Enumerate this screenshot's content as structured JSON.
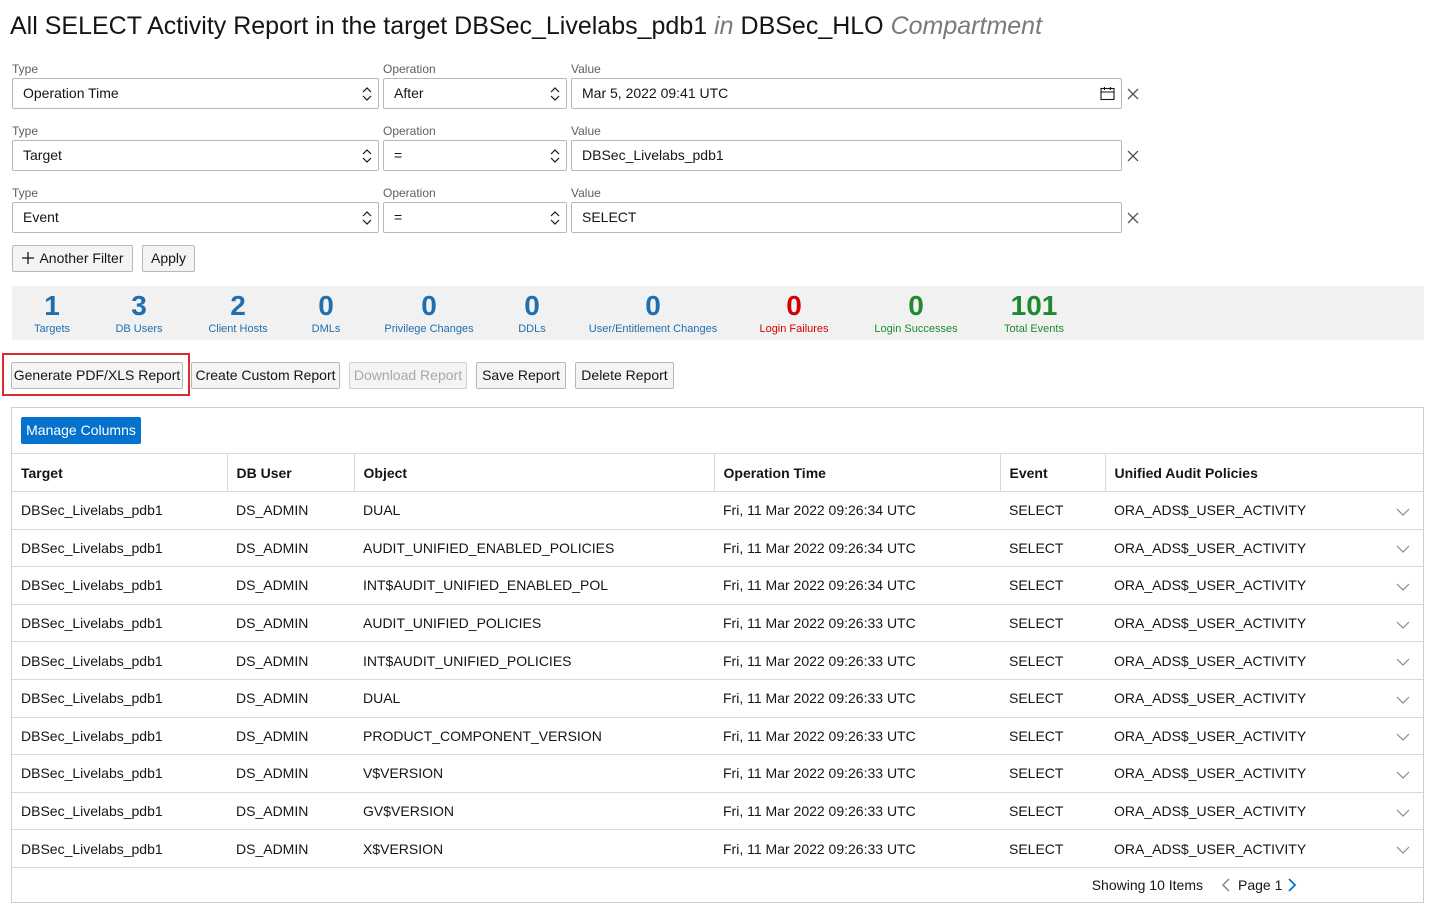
{
  "title": {
    "part1": "All SELECT Activity Report in the target DBSec_Livelabs_pdb1",
    "part2": "in",
    "part3": "DBSec_HLO",
    "part4": "Compartment"
  },
  "filters": [
    {
      "type_label": "Type",
      "type_value": "Operation Time",
      "op_label": "Operation",
      "op_value": "After",
      "value_label": "Value",
      "value": "Mar 5, 2022 09:41 UTC",
      "has_calendar": true
    },
    {
      "type_label": "Type",
      "type_value": "Target",
      "op_label": "Operation",
      "op_value": "=",
      "value_label": "Value",
      "value": "DBSec_Livelabs_pdb1",
      "has_calendar": false
    },
    {
      "type_label": "Type",
      "type_value": "Event",
      "op_label": "Operation",
      "op_value": "=",
      "value_label": "Value",
      "value": "SELECT",
      "has_calendar": false
    }
  ],
  "filter_actions": {
    "another_filter": "Another Filter",
    "apply": "Apply"
  },
  "stats": [
    {
      "value": "1",
      "label": "Targets",
      "color": "#1f6fb0"
    },
    {
      "value": "3",
      "label": "DB Users",
      "color": "#1f6fb0"
    },
    {
      "value": "2",
      "label": "Client Hosts",
      "color": "#1f6fb0"
    },
    {
      "value": "0",
      "label": "DMLs",
      "color": "#1f6fb0"
    },
    {
      "value": "0",
      "label": "Privilege Changes",
      "color": "#1f6fb0"
    },
    {
      "value": "0",
      "label": "DDLs",
      "color": "#1f6fb0"
    },
    {
      "value": "0",
      "label": "User/Entitlement Changes",
      "color": "#1f6fb0"
    },
    {
      "value": "0",
      "label": "Login Failures",
      "color": "#d40000"
    },
    {
      "value": "0",
      "label": "Login Successes",
      "color": "#1e8a30"
    },
    {
      "value": "101",
      "label": "Total Events",
      "color": "#1e8a30"
    }
  ],
  "report_buttons": {
    "generate": "Generate PDF/XLS Report",
    "create_custom": "Create Custom Report",
    "download": "Download Report",
    "save": "Save Report",
    "delete": "Delete Report"
  },
  "table": {
    "manage_columns": "Manage Columns",
    "headers": [
      "Target",
      "DB User",
      "Object",
      "Operation Time",
      "Event",
      "Unified Audit Policies"
    ],
    "rows": [
      [
        "DBSec_Livelabs_pdb1",
        "DS_ADMIN",
        "DUAL",
        "Fri, 11 Mar 2022 09:26:34 UTC",
        "SELECT",
        "ORA_ADS$_USER_ACTIVITY"
      ],
      [
        "DBSec_Livelabs_pdb1",
        "DS_ADMIN",
        "AUDIT_UNIFIED_ENABLED_POLICIES",
        "Fri, 11 Mar 2022 09:26:34 UTC",
        "SELECT",
        "ORA_ADS$_USER_ACTIVITY"
      ],
      [
        "DBSec_Livelabs_pdb1",
        "DS_ADMIN",
        "INT$AUDIT_UNIFIED_ENABLED_POL",
        "Fri, 11 Mar 2022 09:26:34 UTC",
        "SELECT",
        "ORA_ADS$_USER_ACTIVITY"
      ],
      [
        "DBSec_Livelabs_pdb1",
        "DS_ADMIN",
        "AUDIT_UNIFIED_POLICIES",
        "Fri, 11 Mar 2022 09:26:33 UTC",
        "SELECT",
        "ORA_ADS$_USER_ACTIVITY"
      ],
      [
        "DBSec_Livelabs_pdb1",
        "DS_ADMIN",
        "INT$AUDIT_UNIFIED_POLICIES",
        "Fri, 11 Mar 2022 09:26:33 UTC",
        "SELECT",
        "ORA_ADS$_USER_ACTIVITY"
      ],
      [
        "DBSec_Livelabs_pdb1",
        "DS_ADMIN",
        "DUAL",
        "Fri, 11 Mar 2022 09:26:33 UTC",
        "SELECT",
        "ORA_ADS$_USER_ACTIVITY"
      ],
      [
        "DBSec_Livelabs_pdb1",
        "DS_ADMIN",
        "PRODUCT_COMPONENT_VERSION",
        "Fri, 11 Mar 2022 09:26:33 UTC",
        "SELECT",
        "ORA_ADS$_USER_ACTIVITY"
      ],
      [
        "DBSec_Livelabs_pdb1",
        "DS_ADMIN",
        "V$VERSION",
        "Fri, 11 Mar 2022 09:26:33 UTC",
        "SELECT",
        "ORA_ADS$_USER_ACTIVITY"
      ],
      [
        "DBSec_Livelabs_pdb1",
        "DS_ADMIN",
        "GV$VERSION",
        "Fri, 11 Mar 2022 09:26:33 UTC",
        "SELECT",
        "ORA_ADS$_USER_ACTIVITY"
      ],
      [
        "DBSec_Livelabs_pdb1",
        "DS_ADMIN",
        "X$VERSION",
        "Fri, 11 Mar 2022 09:26:33 UTC",
        "SELECT",
        "ORA_ADS$_USER_ACTIVITY"
      ]
    ],
    "footer": {
      "showing": "Showing 10 Items",
      "page": "Page 1"
    }
  },
  "colors": {
    "primary": "#0572ce",
    "highlight": "#e0292f"
  }
}
